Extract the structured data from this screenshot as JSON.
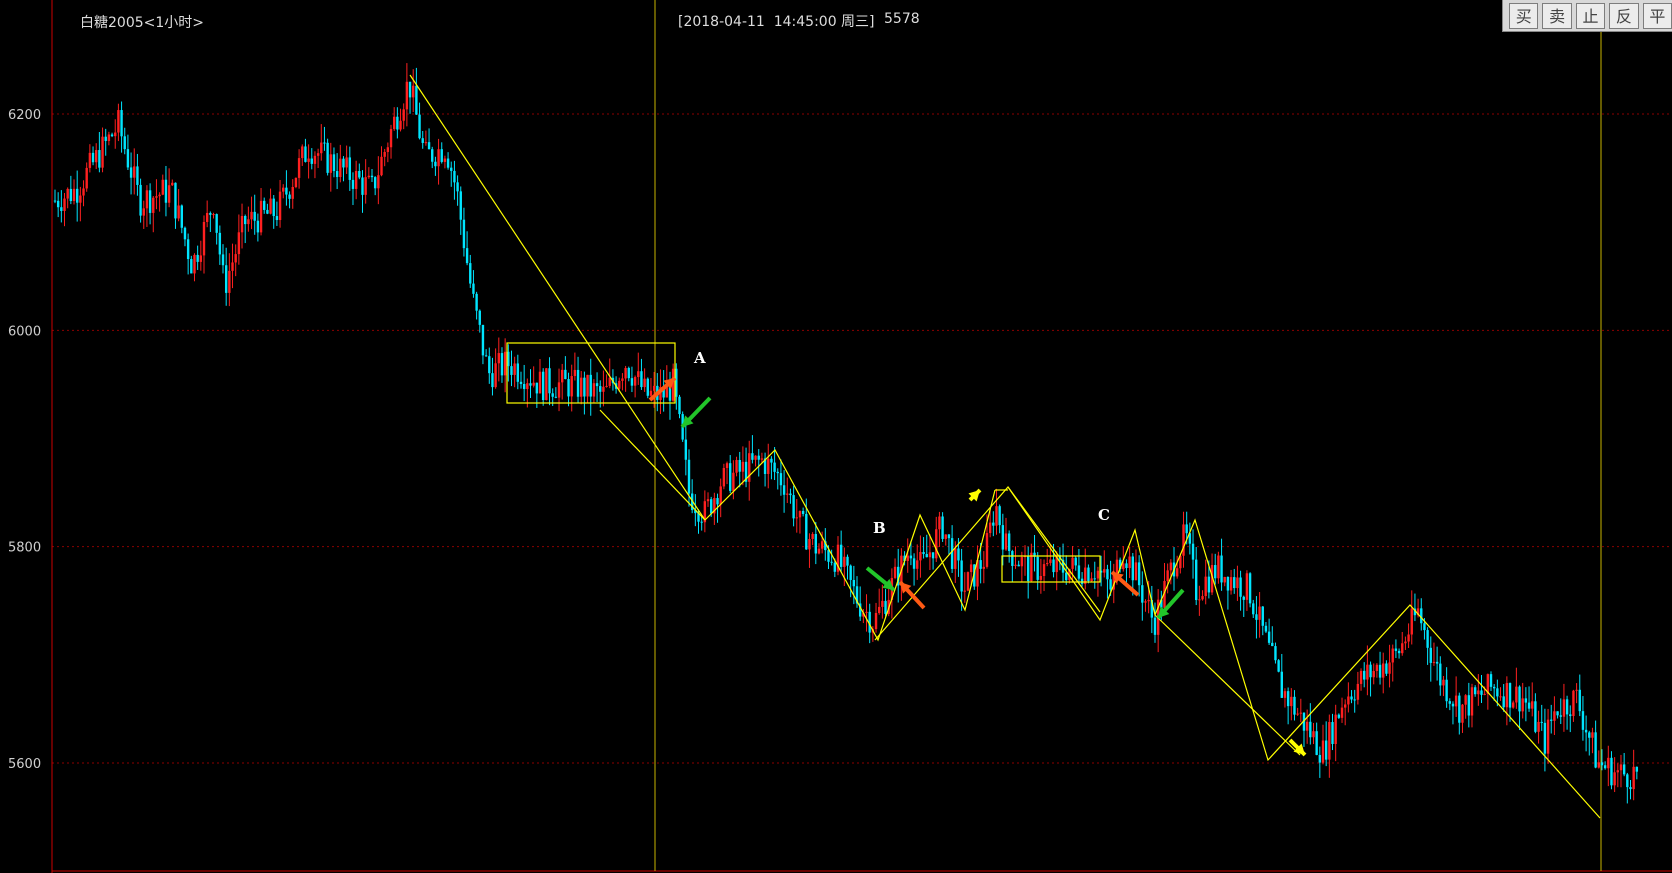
{
  "window": {
    "instrument_title": "白糖2005<1小时>",
    "crosshair_info": "[2018-04-11  14:45:00 周三]",
    "crosshair_value": "5578"
  },
  "toolbar": {
    "buttons": [
      {
        "label": "买"
      },
      {
        "label": "卖"
      },
      {
        "label": "止"
      },
      {
        "label": "反"
      },
      {
        "label": "平"
      }
    ]
  },
  "annotations": {
    "labels": [
      "A",
      "B",
      "C"
    ]
  },
  "colors": {
    "background": "#000000",
    "up_candle": "#ff2020",
    "down_candle": "#00e5ff",
    "grid": "#8b0000",
    "axis": "#cc0000",
    "trendline": "#ffff00",
    "arrow_orange": "#ff5a14",
    "arrow_green": "#22c52a",
    "text": "#dddddd"
  },
  "chart_data": {
    "type": "candlestick",
    "title": "白糖2005<1小时>",
    "ylim": [
      5500,
      6300
    ],
    "y_ticks": [
      6200,
      6000,
      5800,
      5600
    ],
    "grid": true,
    "price_path": [
      [
        0,
        6120
      ],
      [
        20,
        6130
      ],
      [
        40,
        6160
      ],
      [
        60,
        6190
      ],
      [
        80,
        6120
      ],
      [
        110,
        6130
      ],
      [
        130,
        6060
      ],
      [
        150,
        6120
      ],
      [
        160,
        6040
      ],
      [
        180,
        6100
      ],
      [
        210,
        6110
      ],
      [
        240,
        6170
      ],
      [
        270,
        6150
      ],
      [
        300,
        6130
      ],
      [
        320,
        6190
      ],
      [
        335,
        6230
      ],
      [
        350,
        6160
      ],
      [
        370,
        6170
      ],
      [
        380,
        6130
      ],
      [
        395,
        6030
      ],
      [
        410,
        5960
      ],
      [
        430,
        5970
      ],
      [
        460,
        5950
      ],
      [
        490,
        5950
      ],
      [
        520,
        5940
      ],
      [
        540,
        5970
      ],
      [
        560,
        5940
      ],
      [
        575,
        5940
      ],
      [
        585,
        5950
      ],
      [
        600,
        5850
      ],
      [
        615,
        5830
      ],
      [
        630,
        5860
      ],
      [
        650,
        5870
      ],
      [
        670,
        5880
      ],
      [
        690,
        5860
      ],
      [
        705,
        5820
      ],
      [
        720,
        5800
      ],
      [
        740,
        5790
      ],
      [
        760,
        5750
      ],
      [
        775,
        5730
      ],
      [
        790,
        5760
      ],
      [
        810,
        5800
      ],
      [
        820,
        5780
      ],
      [
        840,
        5820
      ],
      [
        860,
        5760
      ],
      [
        880,
        5790
      ],
      [
        890,
        5840
      ],
      [
        900,
        5800
      ],
      [
        920,
        5780
      ],
      [
        960,
        5780
      ],
      [
        985,
        5780
      ],
      [
        1000,
        5760
      ],
      [
        1010,
        5800
      ],
      [
        1020,
        5780
      ],
      [
        1040,
        5730
      ],
      [
        1060,
        5790
      ],
      [
        1070,
        5810
      ],
      [
        1080,
        5760
      ],
      [
        1100,
        5780
      ],
      [
        1130,
        5760
      ],
      [
        1150,
        5700
      ],
      [
        1160,
        5670
      ],
      [
        1180,
        5640
      ],
      [
        1200,
        5610
      ],
      [
        1220,
        5660
      ],
      [
        1240,
        5680
      ],
      [
        1270,
        5700
      ],
      [
        1290,
        5740
      ],
      [
        1310,
        5680
      ],
      [
        1330,
        5650
      ],
      [
        1360,
        5670
      ],
      [
        1390,
        5660
      ],
      [
        1410,
        5620
      ],
      [
        1420,
        5650
      ],
      [
        1440,
        5660
      ],
      [
        1460,
        5600
      ],
      [
        1480,
        5590
      ],
      [
        1500,
        5590
      ]
    ],
    "overlays": {
      "trendlines": [
        {
          "from": [
            6240,
            0
          ],
          "to": [
            5940,
            0
          ]
        },
        {
          "from": [
            5820,
            0
          ],
          "to": [
            5890,
            0
          ]
        }
      ],
      "boxes": [
        {
          "label": "A",
          "top": 5990,
          "bottom": 5930
        },
        {
          "label": "C",
          "top": 5790,
          "bottom": 5770
        }
      ]
    }
  }
}
